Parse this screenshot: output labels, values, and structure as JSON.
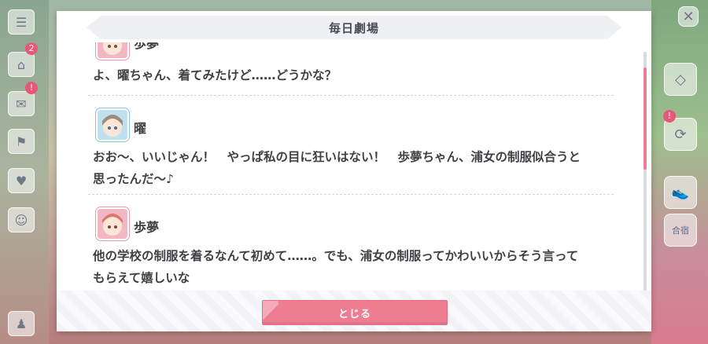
{
  "dialog": {
    "title": "毎日劇場",
    "close_label": "とじる"
  },
  "entries": [
    {
      "speaker": "歩夢",
      "avatar": "ayumu-avatar",
      "lines": [
        "よ、曜ちゃん、着てみたけど……どうかな？"
      ]
    },
    {
      "speaker": "曜",
      "avatar": "you-avatar",
      "lines": [
        "おお～、いいじゃん！　やっぱ私の目に狂いはない！　歩夢ちゃん、浦女の制服似合うと",
        "思ったんだ～♪"
      ]
    },
    {
      "speaker": "歩夢",
      "avatar": "ayumu-avatar",
      "lines": [
        "他の学校の制服を着るなんて初めて……。でも、浦女の制服ってかわいいからそう言って",
        "もらえて嬉しいな"
      ]
    }
  ],
  "background": {
    "left_badges": [
      "2",
      "!",
      "!"
    ],
    "right_label": "合宿"
  },
  "colors": {
    "accent": "#ee7d92",
    "text": "#3f3f46",
    "header_band": "#eff0f4"
  }
}
